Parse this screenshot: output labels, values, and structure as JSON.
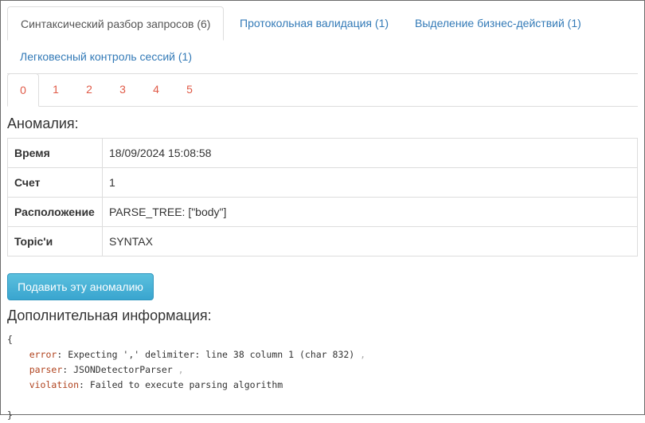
{
  "tabs": {
    "main": [
      {
        "label": "Синтаксический разбор запросов (6)"
      },
      {
        "label": "Протокольная валидация (1)"
      },
      {
        "label": "Выделение бизнес-действий (1)"
      },
      {
        "label": "Легковесный контроль сессий (1)"
      }
    ],
    "sub": [
      "0",
      "1",
      "2",
      "3",
      "4",
      "5"
    ]
  },
  "anomaly": {
    "heading": "Аномалия:",
    "rows": [
      {
        "key": "Время",
        "value": "18/09/2024 15:08:58"
      },
      {
        "key": "Счет",
        "value": "1"
      },
      {
        "key": "Расположение",
        "value": "PARSE_TREE: [\"body\"]"
      },
      {
        "key": "Topic'и",
        "value": "SYNTAX"
      }
    ]
  },
  "actions": {
    "suppress_label": "Подавить эту аномалию"
  },
  "extra": {
    "heading": "Дополнительная информация:",
    "open_brace": "{",
    "close_brace": "}",
    "fields": [
      {
        "key": "error",
        "value": "Expecting ',' delimiter: line 38 column 1 (char 832)",
        "comma": ","
      },
      {
        "key": "parser",
        "value": "JSONDetectorParser",
        "comma": ","
      },
      {
        "key": "violation",
        "value": "Failed to execute parsing algorithm",
        "comma": ""
      }
    ]
  },
  "colors": {
    "link": "#337ab7",
    "subtab": "#e05a47",
    "button": "#5bc0de"
  }
}
